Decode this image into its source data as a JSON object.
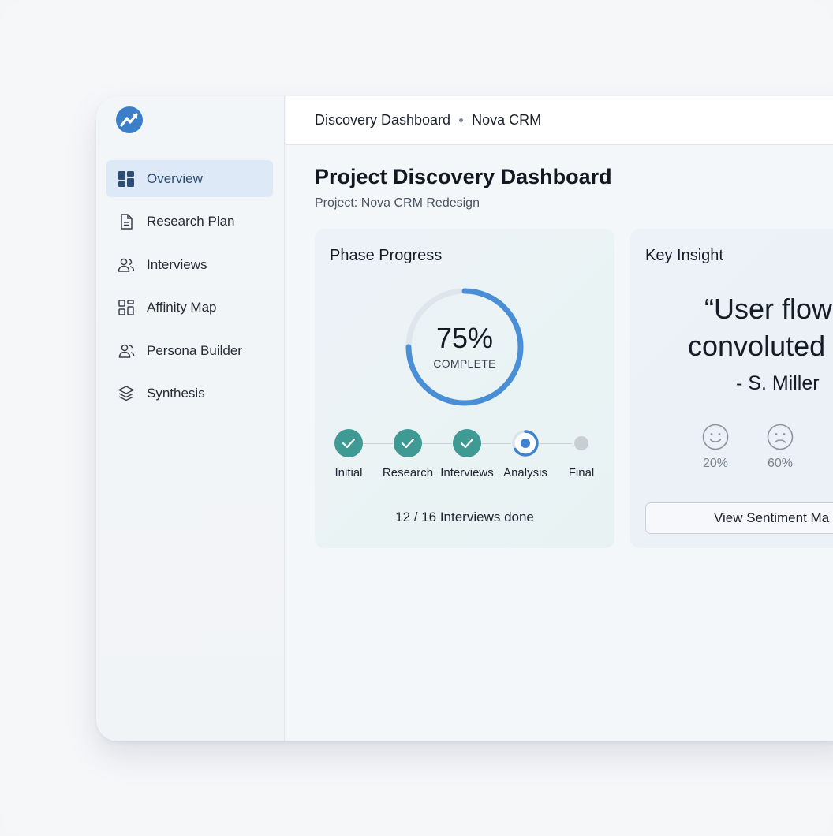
{
  "header": {
    "breadcrumb_page": "Discovery Dashboard",
    "breadcrumb_project": "Nova CRM"
  },
  "sidebar": {
    "items": [
      {
        "label": "Overview",
        "icon": "dashboard-grid-icon",
        "active": true
      },
      {
        "label": "Research Plan",
        "icon": "document-icon",
        "active": false
      },
      {
        "label": "Interviews",
        "icon": "users-icon",
        "active": false
      },
      {
        "label": "Affinity Map",
        "icon": "affinity-grid-icon",
        "active": false
      },
      {
        "label": "Persona Builder",
        "icon": "persona-icon",
        "active": false
      },
      {
        "label": "Synthesis",
        "icon": "layers-icon",
        "active": false
      }
    ]
  },
  "main": {
    "title": "Project Discovery Dashboard",
    "subtitle": "Project: Nova CRM Redesign"
  },
  "phase_card": {
    "title": "Phase Progress",
    "percent_label": "75%",
    "progress_fraction": 0.75,
    "complete_label": "COMPLETE",
    "steps": [
      {
        "label": "Initial",
        "status": "done"
      },
      {
        "label": "Research",
        "status": "done"
      },
      {
        "label": "Interviews",
        "status": "done"
      },
      {
        "label": "Analysis",
        "status": "current"
      },
      {
        "label": "Final",
        "status": "pending"
      }
    ],
    "interviews_done": "12 / 16 Interviews done"
  },
  "insight_card": {
    "title": "Key Insight",
    "quote_line1": "“User flow is",
    "quote_line2": "convoluted",
    "author": "- S. Miller",
    "sentiments": [
      {
        "icon": "smile-icon",
        "value": "20%"
      },
      {
        "icon": "frown-icon",
        "value": "60%"
      }
    ],
    "button_label": "View Sentiment Ma"
  },
  "colors": {
    "accent_blue": "#4a8fd6",
    "step_done": "#3f9a93",
    "active_nav_bg": "#dde9f7"
  }
}
